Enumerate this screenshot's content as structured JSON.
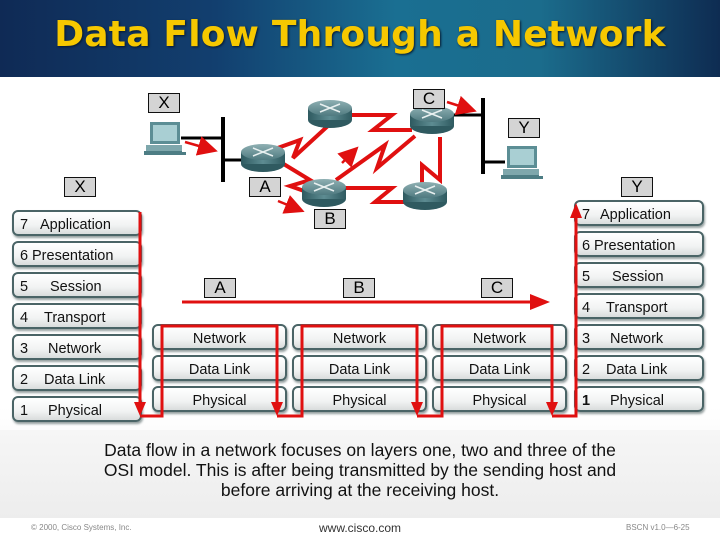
{
  "header": {
    "title": "Data Flow Through a Network"
  },
  "topology": {
    "hosts": [
      {
        "id": "host-x",
        "label": "X",
        "icon": "computer-icon"
      },
      {
        "id": "host-y",
        "label": "Y",
        "icon": "computer-icon"
      }
    ],
    "routers": [
      {
        "id": "router-a",
        "label": "A",
        "icon": "router-icon"
      },
      {
        "id": "router-b",
        "label": "B",
        "icon": "router-icon"
      },
      {
        "id": "router-c",
        "label": "C",
        "icon": "router-icon"
      },
      {
        "id": "router-top",
        "label": "",
        "icon": "router-icon"
      },
      {
        "id": "router-bottom",
        "label": "",
        "icon": "router-icon"
      }
    ],
    "link_color": "#e01010"
  },
  "osi": {
    "sender_label": "X",
    "receiver_label": "Y",
    "sender_layers": [
      {
        "num": "7",
        "name": "Application"
      },
      {
        "num": "6",
        "name": "Presentation"
      },
      {
        "num": "5",
        "name": "Session"
      },
      {
        "num": "4",
        "name": "Transport"
      },
      {
        "num": "3",
        "name": "Network"
      },
      {
        "num": "2",
        "name": "Data Link"
      },
      {
        "num": "1",
        "name": "Physical"
      }
    ],
    "receiver_layers": [
      {
        "num": "7",
        "name": "Application"
      },
      {
        "num": "6",
        "name": "Presentation"
      },
      {
        "num": "5",
        "name": "Session"
      },
      {
        "num": "4",
        "name": "Transport"
      },
      {
        "num": "3",
        "name": "Network"
      },
      {
        "num": "2",
        "name": "Data Link"
      },
      {
        "num": "1",
        "name": "Physical"
      }
    ],
    "routers": [
      {
        "label": "A",
        "layers": [
          "Network",
          "Data Link",
          "Physical"
        ]
      },
      {
        "label": "B",
        "layers": [
          "Network",
          "Data Link",
          "Physical"
        ]
      },
      {
        "label": "C",
        "layers": [
          "Network",
          "Data Link",
          "Physical"
        ]
      }
    ],
    "flow_color": "#e01010"
  },
  "caption": {
    "line1": "Data flow in a network focuses on layers one, two and three of the",
    "line2": "OSI model. This is after being transmitted by the sending host and",
    "line3": "before arriving at the receiving host."
  },
  "footer": {
    "copyright": "© 2000, Cisco Systems, Inc.",
    "url": "www.cisco.com",
    "slide_id": "BSCN v1.0—6-25"
  }
}
